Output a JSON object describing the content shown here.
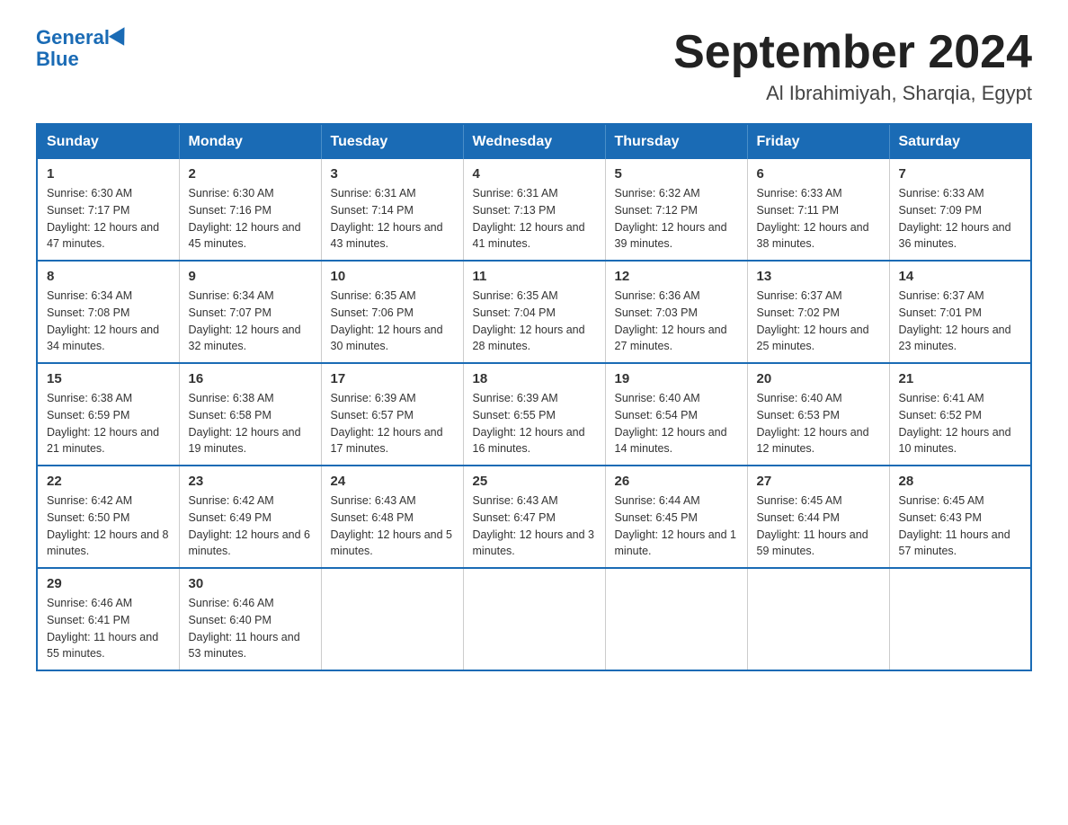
{
  "header": {
    "logo_line1": "General",
    "logo_line2": "Blue",
    "title": "September 2024",
    "subtitle": "Al Ibrahimiyah, Sharqia, Egypt"
  },
  "days_of_week": [
    "Sunday",
    "Monday",
    "Tuesday",
    "Wednesday",
    "Thursday",
    "Friday",
    "Saturday"
  ],
  "weeks": [
    [
      {
        "day": "1",
        "sunrise": "6:30 AM",
        "sunset": "7:17 PM",
        "daylight": "12 hours and 47 minutes."
      },
      {
        "day": "2",
        "sunrise": "6:30 AM",
        "sunset": "7:16 PM",
        "daylight": "12 hours and 45 minutes."
      },
      {
        "day": "3",
        "sunrise": "6:31 AM",
        "sunset": "7:14 PM",
        "daylight": "12 hours and 43 minutes."
      },
      {
        "day": "4",
        "sunrise": "6:31 AM",
        "sunset": "7:13 PM",
        "daylight": "12 hours and 41 minutes."
      },
      {
        "day": "5",
        "sunrise": "6:32 AM",
        "sunset": "7:12 PM",
        "daylight": "12 hours and 39 minutes."
      },
      {
        "day": "6",
        "sunrise": "6:33 AM",
        "sunset": "7:11 PM",
        "daylight": "12 hours and 38 minutes."
      },
      {
        "day": "7",
        "sunrise": "6:33 AM",
        "sunset": "7:09 PM",
        "daylight": "12 hours and 36 minutes."
      }
    ],
    [
      {
        "day": "8",
        "sunrise": "6:34 AM",
        "sunset": "7:08 PM",
        "daylight": "12 hours and 34 minutes."
      },
      {
        "day": "9",
        "sunrise": "6:34 AM",
        "sunset": "7:07 PM",
        "daylight": "12 hours and 32 minutes."
      },
      {
        "day": "10",
        "sunrise": "6:35 AM",
        "sunset": "7:06 PM",
        "daylight": "12 hours and 30 minutes."
      },
      {
        "day": "11",
        "sunrise": "6:35 AM",
        "sunset": "7:04 PM",
        "daylight": "12 hours and 28 minutes."
      },
      {
        "day": "12",
        "sunrise": "6:36 AM",
        "sunset": "7:03 PM",
        "daylight": "12 hours and 27 minutes."
      },
      {
        "day": "13",
        "sunrise": "6:37 AM",
        "sunset": "7:02 PM",
        "daylight": "12 hours and 25 minutes."
      },
      {
        "day": "14",
        "sunrise": "6:37 AM",
        "sunset": "7:01 PM",
        "daylight": "12 hours and 23 minutes."
      }
    ],
    [
      {
        "day": "15",
        "sunrise": "6:38 AM",
        "sunset": "6:59 PM",
        "daylight": "12 hours and 21 minutes."
      },
      {
        "day": "16",
        "sunrise": "6:38 AM",
        "sunset": "6:58 PM",
        "daylight": "12 hours and 19 minutes."
      },
      {
        "day": "17",
        "sunrise": "6:39 AM",
        "sunset": "6:57 PM",
        "daylight": "12 hours and 17 minutes."
      },
      {
        "day": "18",
        "sunrise": "6:39 AM",
        "sunset": "6:55 PM",
        "daylight": "12 hours and 16 minutes."
      },
      {
        "day": "19",
        "sunrise": "6:40 AM",
        "sunset": "6:54 PM",
        "daylight": "12 hours and 14 minutes."
      },
      {
        "day": "20",
        "sunrise": "6:40 AM",
        "sunset": "6:53 PM",
        "daylight": "12 hours and 12 minutes."
      },
      {
        "day": "21",
        "sunrise": "6:41 AM",
        "sunset": "6:52 PM",
        "daylight": "12 hours and 10 minutes."
      }
    ],
    [
      {
        "day": "22",
        "sunrise": "6:42 AM",
        "sunset": "6:50 PM",
        "daylight": "12 hours and 8 minutes."
      },
      {
        "day": "23",
        "sunrise": "6:42 AM",
        "sunset": "6:49 PM",
        "daylight": "12 hours and 6 minutes."
      },
      {
        "day": "24",
        "sunrise": "6:43 AM",
        "sunset": "6:48 PM",
        "daylight": "12 hours and 5 minutes."
      },
      {
        "day": "25",
        "sunrise": "6:43 AM",
        "sunset": "6:47 PM",
        "daylight": "12 hours and 3 minutes."
      },
      {
        "day": "26",
        "sunrise": "6:44 AM",
        "sunset": "6:45 PM",
        "daylight": "12 hours and 1 minute."
      },
      {
        "day": "27",
        "sunrise": "6:45 AM",
        "sunset": "6:44 PM",
        "daylight": "11 hours and 59 minutes."
      },
      {
        "day": "28",
        "sunrise": "6:45 AM",
        "sunset": "6:43 PM",
        "daylight": "11 hours and 57 minutes."
      }
    ],
    [
      {
        "day": "29",
        "sunrise": "6:46 AM",
        "sunset": "6:41 PM",
        "daylight": "11 hours and 55 minutes."
      },
      {
        "day": "30",
        "sunrise": "6:46 AM",
        "sunset": "6:40 PM",
        "daylight": "11 hours and 53 minutes."
      },
      null,
      null,
      null,
      null,
      null
    ]
  ]
}
